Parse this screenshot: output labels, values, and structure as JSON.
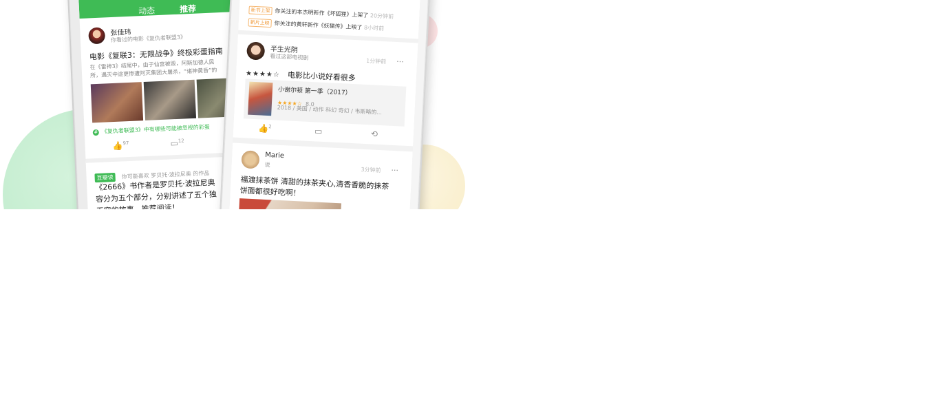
{
  "colors": {
    "brand_green": "#3fbb55",
    "star_orange": "#f5a623",
    "notice_orange": "#f09a3a"
  },
  "left_phone": {
    "tabs": [
      {
        "label": "动态"
      },
      {
        "label": "推荐"
      }
    ],
    "active_tab": "推荐",
    "post1": {
      "user_name": "张佳玮",
      "user_sub": "你看过的电影《复仇者联盟3》",
      "title": "电影《复联3：无限战争》终极彩蛋指南",
      "desc_line1": "在《雷神3》结尾中，由于仙宫被毁，阿斯加德人民",
      "desc_line2": "所，遇灭中途更惨遭阿灭集团大屠杀，“诸神黄昏”的",
      "topic": "《复仇者联盟3》中有哪些可能被忽视的彩蛋",
      "likes": "97",
      "comments": "12"
    },
    "post2": {
      "badge": "豆瓣读",
      "sub": "你可能喜欢 罗贝托·波拉尼奥 的作品",
      "line1": "《2666》书作者是罗贝托·波拉尼奥",
      "line2": "容分为五个部分，分别讲述了五个独",
      "line3": "无穷的故事，推荐阅读！"
    }
  },
  "right_phone": {
    "notices": [
      {
        "tag": "新书上架",
        "text": "你关注的本杰明新作《坏狐狸》上架了",
        "time": "20分钟前"
      },
      {
        "tag": "新片上映",
        "text": "你关注的黄轩新作《妖猫传》上映了",
        "time": "8小时前"
      }
    ],
    "post1": {
      "user_name": "半生光阴",
      "user_sub": "看过这部电视剧",
      "time": "1分钟前",
      "rating_stars": "★★★★☆",
      "comment": "电影比小说好看很多",
      "movie_title": "小谢尔顿 第一季（2017）",
      "movie_stars": "★★★★☆",
      "movie_score": "8.0",
      "movie_meta": "2018 / 美国 / 动作 科幻 奇幻 / 韦斯略的...",
      "likes": "2"
    },
    "post2": {
      "user_name": "Marie",
      "user_sub": "说",
      "time": "3分钟前",
      "text_line1": "福渡抹茶饼 清甜的抹茶夹心,清香香脆的抹茶",
      "text_line2": "饼面都很好吃啊！"
    }
  },
  "icons": {
    "like": "like-icon",
    "comment": "comment-icon",
    "repost": "repost-icon",
    "more": "more-icon"
  }
}
